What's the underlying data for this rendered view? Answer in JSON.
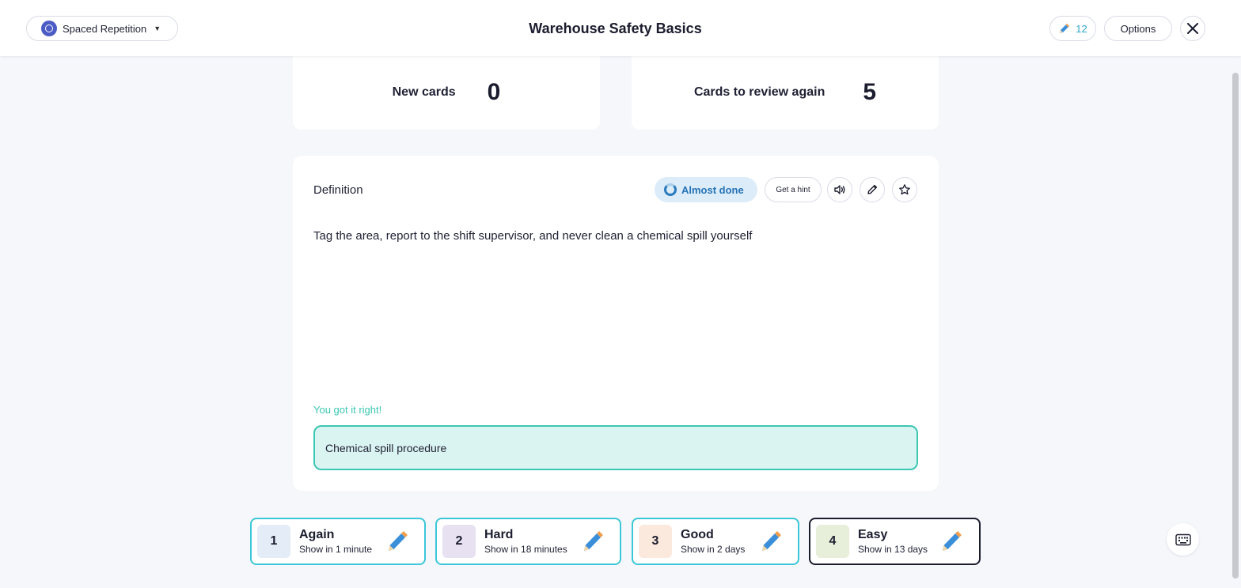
{
  "header": {
    "mode_label": "Spaced Repetition",
    "title": "Warehouse Safety Basics",
    "pencil_count": "12",
    "options_label": "Options"
  },
  "stats": {
    "new_label": "New cards",
    "new_value": "0",
    "review_label": "Cards to review again",
    "review_value": "5"
  },
  "card": {
    "side_label": "Definition",
    "status_label": "Almost done",
    "hint_label": "Get a hint",
    "definition": "Tag the area, report to the shift supervisor, and never clean a chemical spill yourself",
    "feedback": "You got it right!",
    "answer": "Chemical spill procedure"
  },
  "ratings": [
    {
      "num": "1",
      "title": "Again",
      "sub": "Show in 1 minute",
      "color": "#e4edf7"
    },
    {
      "num": "2",
      "title": "Hard",
      "sub": "Show in 18 minutes",
      "color": "#e7e1f1"
    },
    {
      "num": "3",
      "title": "Good",
      "sub": "Show in 2 days",
      "color": "#fbe9dd"
    },
    {
      "num": "4",
      "title": "Easy",
      "sub": "Show in 13 days",
      "color": "#e7efdb"
    }
  ],
  "colors": {
    "accent_teal": "#3cc7b3",
    "rating_border": "#3cc7d8",
    "status_blue": "#2573b5"
  },
  "icons": [
    "mode-icon",
    "chevron-down-icon",
    "pencil-icon",
    "close-icon",
    "spinner-icon",
    "speaker-icon",
    "edit-icon",
    "star-icon",
    "keyboard-icon"
  ]
}
